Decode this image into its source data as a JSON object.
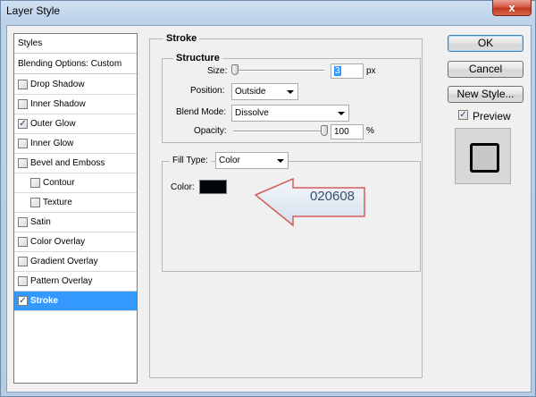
{
  "window": {
    "title": "Layer Style",
    "close_glyph": "x"
  },
  "styles_panel": {
    "header": "Styles",
    "blending_options": "Blending Options: Custom",
    "items": [
      {
        "label": "Drop Shadow",
        "checked": false,
        "indent": false,
        "active": false
      },
      {
        "label": "Inner Shadow",
        "checked": false,
        "indent": false,
        "active": false
      },
      {
        "label": "Outer Glow",
        "checked": true,
        "indent": false,
        "active": false
      },
      {
        "label": "Inner Glow",
        "checked": false,
        "indent": false,
        "active": false
      },
      {
        "label": "Bevel and Emboss",
        "checked": false,
        "indent": false,
        "active": false
      },
      {
        "label": "Contour",
        "checked": false,
        "indent": true,
        "active": false
      },
      {
        "label": "Texture",
        "checked": false,
        "indent": true,
        "active": false
      },
      {
        "label": "Satin",
        "checked": false,
        "indent": false,
        "active": false
      },
      {
        "label": "Color Overlay",
        "checked": false,
        "indent": false,
        "active": false
      },
      {
        "label": "Gradient Overlay",
        "checked": false,
        "indent": false,
        "active": false
      },
      {
        "label": "Pattern Overlay",
        "checked": false,
        "indent": false,
        "active": false
      },
      {
        "label": "Stroke",
        "checked": true,
        "indent": false,
        "active": true
      }
    ]
  },
  "stroke": {
    "section_title": "Stroke",
    "structure_title": "Structure",
    "size_label": "Size:",
    "size_value": "3",
    "size_unit": "px",
    "size_fraction": 0.02,
    "position_label": "Position:",
    "position_value": "Outside",
    "blend_mode_label": "Blend Mode:",
    "blend_mode_value": "Dissolve",
    "opacity_label": "Opacity:",
    "opacity_value": "100",
    "opacity_unit": "%",
    "opacity_fraction": 1.0,
    "fill_type_label": "Fill Type:",
    "fill_type_value": "Color",
    "color_label": "Color:",
    "color_swatch": "#020608"
  },
  "buttons": {
    "ok": "OK",
    "cancel": "Cancel",
    "new_style": "New Style...",
    "preview_label": "Preview",
    "preview_checked": true
  },
  "callout": {
    "text": "020608"
  }
}
